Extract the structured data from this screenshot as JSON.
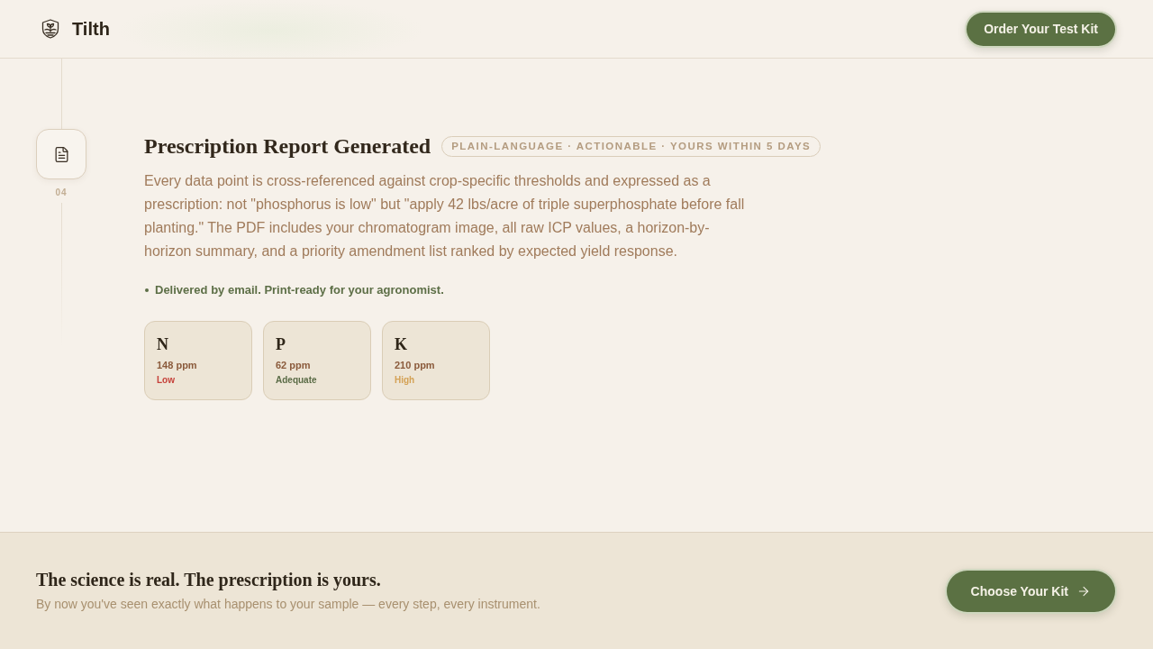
{
  "header": {
    "brand": "Tilth",
    "cta": "Order Your Test Kit"
  },
  "step": {
    "number": "04",
    "title": "Prescription Report Generated",
    "badge": "PLAIN-LANGUAGE · ACTIONABLE · YOURS WITHIN 5 DAYS",
    "description": "Every data point is cross-referenced against crop-specific thresholds and expressed as a prescription: not \"phosphorus is low\" but \"apply 42 lbs/acre of triple superphosphate before fall planting.\" The PDF includes your chromatogram image, all raw ICP values, a horizon-by-horizon summary, and a priority amendment list ranked by expected yield response.",
    "bullets": [
      "Delivered by email. Print-ready for your agronomist."
    ],
    "nutrients": [
      {
        "symbol": "N",
        "reading": "148 ppm",
        "status": "Low",
        "color": "#c6413a"
      },
      {
        "symbol": "P",
        "reading": "62 ppm",
        "status": "Adequate",
        "color": "#5b6c47"
      },
      {
        "symbol": "K",
        "reading": "210 ppm",
        "status": "High",
        "color": "#d4a256"
      }
    ]
  },
  "footer": {
    "heading": "The science is real. The prescription is yours.",
    "subtext": "By now you've seen exactly what happens to your sample — every step, every instrument.",
    "cta": "Choose Your Kit"
  }
}
